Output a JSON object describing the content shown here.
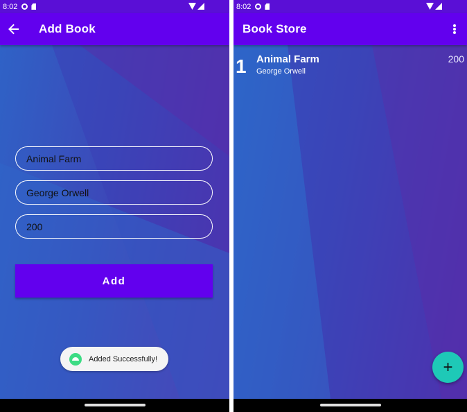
{
  "colors": {
    "primary": "#6200ee",
    "status_bar": "#5a0fd6",
    "fab": "#1ec9b7",
    "toast_icon": "#3ddc84"
  },
  "left_screen": {
    "status_bar": {
      "time": "8:02",
      "icons": [
        "circle-icon",
        "sd-card-icon",
        "wifi-icon",
        "signal-icon"
      ]
    },
    "app_bar": {
      "back_icon": "arrow-back-icon",
      "title": "Add Book"
    },
    "form": {
      "title_value": "Animal Farm",
      "author_value": "George Orwell",
      "price_value": "200",
      "add_label": "Add"
    },
    "toast": {
      "icon": "android-icon",
      "message": "Added Successfully!"
    }
  },
  "right_screen": {
    "status_bar": {
      "time": "8:02",
      "icons": [
        "circle-icon",
        "sd-card-icon",
        "wifi-icon",
        "signal-icon"
      ]
    },
    "app_bar": {
      "title": "Book Store",
      "menu_icon": "more-vert-icon"
    },
    "books": [
      {
        "index": "1",
        "title": "Animal Farm",
        "author": "George Orwell",
        "price": "200"
      }
    ],
    "fab": {
      "label": "+",
      "icon": "plus-icon"
    }
  }
}
